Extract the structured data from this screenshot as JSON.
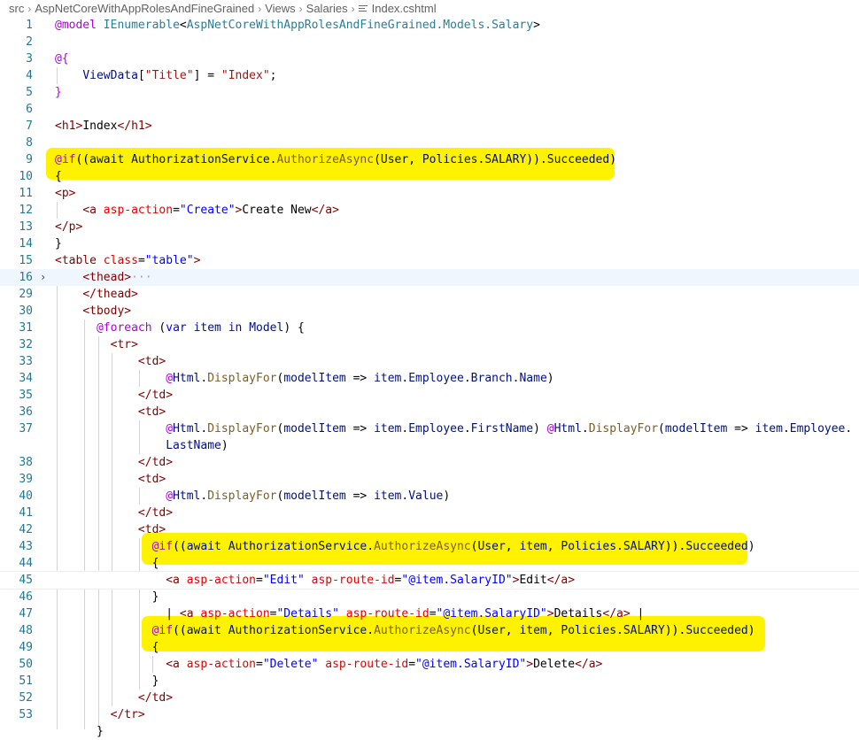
{
  "breadcrumb": {
    "parts": [
      "src",
      "AspNetCoreWithAppRolesAndFineGrained",
      "Views",
      "Salaries",
      "Index.cshtml"
    ]
  },
  "lines": [
    {
      "n": "1",
      "t": [
        [
          "at",
          "@model"
        ],
        [
          "txt",
          " "
        ],
        [
          "type",
          "IEnumerable"
        ],
        [
          "txt",
          "<"
        ],
        [
          "type",
          "AspNetCoreWithAppRolesAndFineGrained.Models.Salary"
        ],
        [
          "txt",
          ">"
        ]
      ]
    },
    {
      "n": "2",
      "t": []
    },
    {
      "n": "3",
      "t": [
        [
          "at",
          "@{"
        ]
      ]
    },
    {
      "n": "4",
      "t": [
        [
          "txt",
          "    "
        ],
        [
          "var",
          "ViewData"
        ],
        [
          "txt",
          "["
        ],
        [
          "str2",
          "\"Title\""
        ],
        [
          "txt",
          "] = "
        ],
        [
          "str2",
          "\"Index\""
        ],
        [
          "txt",
          ";"
        ]
      ]
    },
    {
      "n": "5",
      "t": [
        [
          "at",
          "}"
        ]
      ]
    },
    {
      "n": "6",
      "t": []
    },
    {
      "n": "7",
      "t": [
        [
          "tag",
          "<h1>"
        ],
        [
          "txt",
          "Index"
        ],
        [
          "tag",
          "</h1>"
        ]
      ]
    },
    {
      "n": "8",
      "t": []
    },
    {
      "n": "9",
      "t": [
        [
          "kwc",
          "@if"
        ],
        [
          "txt",
          "(("
        ],
        [
          "var",
          "await"
        ],
        [
          "txt",
          " "
        ],
        [
          "var",
          "AuthorizationService"
        ],
        [
          "txt",
          "."
        ],
        [
          "fn",
          "AuthorizeAsync"
        ],
        [
          "txt",
          "("
        ],
        [
          "var",
          "User"
        ],
        [
          "txt",
          ", "
        ],
        [
          "var",
          "Policies"
        ],
        [
          "txt",
          "."
        ],
        [
          "var",
          "SALARY"
        ],
        [
          "txt",
          "))."
        ],
        [
          "var",
          "Succeeded"
        ],
        [
          "txt",
          ")"
        ]
      ]
    },
    {
      "n": "10",
      "t": [
        [
          "txt",
          "{"
        ]
      ]
    },
    {
      "n": "11",
      "t": [
        [
          "tag",
          "<p>"
        ]
      ]
    },
    {
      "n": "12",
      "t": [
        [
          "txt",
          "    "
        ],
        [
          "tag",
          "<a"
        ],
        [
          "txt",
          " "
        ],
        [
          "attr",
          "asp-action"
        ],
        [
          "txt",
          "="
        ],
        [
          "str",
          "\"Create\""
        ],
        [
          "tag",
          ">"
        ],
        [
          "txt",
          "Create New"
        ],
        [
          "tag",
          "</a>"
        ]
      ]
    },
    {
      "n": "13",
      "t": [
        [
          "tag",
          "</p>"
        ]
      ]
    },
    {
      "n": "14",
      "t": [
        [
          "txt",
          "}"
        ]
      ]
    },
    {
      "n": "15",
      "t": [
        [
          "tag",
          "<table"
        ],
        [
          "txt",
          " "
        ],
        [
          "attr",
          "class"
        ],
        [
          "txt",
          "="
        ],
        [
          "str",
          "\"table\""
        ],
        [
          "tag",
          ">"
        ]
      ]
    },
    {
      "n": "16",
      "t": [
        [
          "txt",
          "    "
        ],
        [
          "tag",
          "<thead>"
        ],
        [
          "ph",
          "···"
        ]
      ]
    },
    {
      "n": "29",
      "t": [
        [
          "txt",
          "    "
        ],
        [
          "tag",
          "</thead>"
        ]
      ]
    },
    {
      "n": "30",
      "t": [
        [
          "txt",
          "    "
        ],
        [
          "tag",
          "<tbody>"
        ]
      ]
    },
    {
      "n": "31",
      "t": [
        [
          "txt",
          "      "
        ],
        [
          "kwc",
          "@foreach"
        ],
        [
          "txt",
          " ("
        ],
        [
          "kw",
          "var"
        ],
        [
          "txt",
          " "
        ],
        [
          "var",
          "item"
        ],
        [
          "txt",
          " "
        ],
        [
          "kw",
          "in"
        ],
        [
          "txt",
          " "
        ],
        [
          "var",
          "Model"
        ],
        [
          "txt",
          ") {"
        ]
      ]
    },
    {
      "n": "32",
      "t": [
        [
          "txt",
          "        "
        ],
        [
          "tag",
          "<tr>"
        ]
      ]
    },
    {
      "n": "33",
      "t": [
        [
          "txt",
          "            "
        ],
        [
          "tag",
          "<td>"
        ]
      ]
    },
    {
      "n": "34",
      "t": [
        [
          "txt",
          "                "
        ],
        [
          "at",
          "@"
        ],
        [
          "var",
          "Html"
        ],
        [
          "txt",
          "."
        ],
        [
          "fn",
          "DisplayFor"
        ],
        [
          "txt",
          "("
        ],
        [
          "var",
          "modelItem"
        ],
        [
          "txt",
          " => "
        ],
        [
          "var",
          "item"
        ],
        [
          "txt",
          "."
        ],
        [
          "var",
          "Employee"
        ],
        [
          "txt",
          "."
        ],
        [
          "var",
          "Branch"
        ],
        [
          "txt",
          "."
        ],
        [
          "var",
          "Name"
        ],
        [
          "txt",
          ")"
        ]
      ]
    },
    {
      "n": "35",
      "t": [
        [
          "txt",
          "            "
        ],
        [
          "tag",
          "</td>"
        ]
      ]
    },
    {
      "n": "36",
      "t": [
        [
          "txt",
          "            "
        ],
        [
          "tag",
          "<td>"
        ]
      ]
    },
    {
      "n": "37",
      "t": [
        [
          "txt",
          "                "
        ],
        [
          "at",
          "@"
        ],
        [
          "var",
          "Html"
        ],
        [
          "txt",
          "."
        ],
        [
          "fn",
          "DisplayFor"
        ],
        [
          "txt",
          "("
        ],
        [
          "var",
          "modelItem"
        ],
        [
          "txt",
          " => "
        ],
        [
          "var",
          "item"
        ],
        [
          "txt",
          "."
        ],
        [
          "var",
          "Employee"
        ],
        [
          "txt",
          "."
        ],
        [
          "var",
          "FirstName"
        ],
        [
          "txt",
          ") "
        ],
        [
          "at",
          "@"
        ],
        [
          "var",
          "Html"
        ],
        [
          "txt",
          "."
        ],
        [
          "fn",
          "DisplayFor"
        ],
        [
          "txt",
          "("
        ],
        [
          "var",
          "modelItem"
        ],
        [
          "txt",
          " => "
        ],
        [
          "var",
          "item"
        ],
        [
          "txt",
          "."
        ],
        [
          "var",
          "Employee"
        ],
        [
          "txt",
          "."
        ]
      ]
    },
    {
      "n": "",
      "t": [
        [
          "txt",
          "                "
        ],
        [
          "var",
          "LastName"
        ],
        [
          "txt",
          ")"
        ]
      ]
    },
    {
      "n": "38",
      "t": [
        [
          "txt",
          "            "
        ],
        [
          "tag",
          "</td>"
        ]
      ]
    },
    {
      "n": "39",
      "t": [
        [
          "txt",
          "            "
        ],
        [
          "tag",
          "<td>"
        ]
      ]
    },
    {
      "n": "40",
      "t": [
        [
          "txt",
          "                "
        ],
        [
          "at",
          "@"
        ],
        [
          "var",
          "Html"
        ],
        [
          "txt",
          "."
        ],
        [
          "fn",
          "DisplayFor"
        ],
        [
          "txt",
          "("
        ],
        [
          "var",
          "modelItem"
        ],
        [
          "txt",
          " => "
        ],
        [
          "var",
          "item"
        ],
        [
          "txt",
          "."
        ],
        [
          "var",
          "Value"
        ],
        [
          "txt",
          ")"
        ]
      ]
    },
    {
      "n": "41",
      "t": [
        [
          "txt",
          "            "
        ],
        [
          "tag",
          "</td>"
        ]
      ]
    },
    {
      "n": "42",
      "t": [
        [
          "txt",
          "            "
        ],
        [
          "tag",
          "<td>"
        ]
      ]
    },
    {
      "n": "43",
      "t": [
        [
          "txt",
          "              "
        ],
        [
          "kwc",
          "@if"
        ],
        [
          "txt",
          "(("
        ],
        [
          "var",
          "await"
        ],
        [
          "txt",
          " "
        ],
        [
          "var",
          "AuthorizationService"
        ],
        [
          "txt",
          "."
        ],
        [
          "fn",
          "AuthorizeAsync"
        ],
        [
          "txt",
          "("
        ],
        [
          "var",
          "User"
        ],
        [
          "txt",
          ", "
        ],
        [
          "var",
          "item"
        ],
        [
          "txt",
          ", "
        ],
        [
          "var",
          "Policies"
        ],
        [
          "txt",
          "."
        ],
        [
          "var",
          "SALARY"
        ],
        [
          "txt",
          "))."
        ],
        [
          "var",
          "Succeeded"
        ],
        [
          "txt",
          ")"
        ]
      ]
    },
    {
      "n": "44",
      "t": [
        [
          "txt",
          "              {"
        ]
      ]
    },
    {
      "n": "45",
      "t": [
        [
          "txt",
          "                "
        ],
        [
          "tag",
          "<a"
        ],
        [
          "txt",
          " "
        ],
        [
          "attr",
          "asp-action"
        ],
        [
          "txt",
          "="
        ],
        [
          "str",
          "\"Edit\""
        ],
        [
          "txt",
          " "
        ],
        [
          "attr",
          "asp-route-id"
        ],
        [
          "txt",
          "="
        ],
        [
          "str",
          "\"@item.SalaryID\""
        ],
        [
          "tag",
          ">"
        ],
        [
          "txt",
          "Edit"
        ],
        [
          "tag",
          "</a>"
        ]
      ]
    },
    {
      "n": "46",
      "t": [
        [
          "txt",
          "              }"
        ]
      ]
    },
    {
      "n": "47",
      "t": [
        [
          "txt",
          "                | "
        ],
        [
          "tag",
          "<a"
        ],
        [
          "txt",
          " "
        ],
        [
          "attr",
          "asp-action"
        ],
        [
          "txt",
          "="
        ],
        [
          "str",
          "\"Details\""
        ],
        [
          "txt",
          " "
        ],
        [
          "attr",
          "asp-route-id"
        ],
        [
          "txt",
          "="
        ],
        [
          "str",
          "\"@item.SalaryID\""
        ],
        [
          "tag",
          ">"
        ],
        [
          "txt",
          "Details"
        ],
        [
          "tag",
          "</a>"
        ],
        [
          "txt",
          " |"
        ]
      ]
    },
    {
      "n": "48",
      "t": [
        [
          "txt",
          "              "
        ],
        [
          "kwc",
          "@if"
        ],
        [
          "txt",
          "(("
        ],
        [
          "var",
          "await"
        ],
        [
          "txt",
          " "
        ],
        [
          "var",
          "AuthorizationService"
        ],
        [
          "txt",
          "."
        ],
        [
          "fn",
          "AuthorizeAsync"
        ],
        [
          "txt",
          "("
        ],
        [
          "var",
          "User"
        ],
        [
          "txt",
          ", "
        ],
        [
          "var",
          "item"
        ],
        [
          "txt",
          ", "
        ],
        [
          "var",
          "Policies"
        ],
        [
          "txt",
          "."
        ],
        [
          "var",
          "SALARY"
        ],
        [
          "txt",
          "))."
        ],
        [
          "var",
          "Succeeded"
        ],
        [
          "txt",
          ")"
        ]
      ]
    },
    {
      "n": "49",
      "t": [
        [
          "txt",
          "              {"
        ]
      ]
    },
    {
      "n": "50",
      "t": [
        [
          "txt",
          "                "
        ],
        [
          "tag",
          "<a"
        ],
        [
          "txt",
          " "
        ],
        [
          "attr",
          "asp-action"
        ],
        [
          "txt",
          "="
        ],
        [
          "str",
          "\"Delete\""
        ],
        [
          "txt",
          " "
        ],
        [
          "attr",
          "asp-route-id"
        ],
        [
          "txt",
          "="
        ],
        [
          "str",
          "\"@item.SalaryID\""
        ],
        [
          "tag",
          ">"
        ],
        [
          "txt",
          "Delete"
        ],
        [
          "tag",
          "</a>"
        ]
      ]
    },
    {
      "n": "51",
      "t": [
        [
          "txt",
          "              }"
        ]
      ]
    },
    {
      "n": "52",
      "t": [
        [
          "txt",
          "            "
        ],
        [
          "tag",
          "</td>"
        ]
      ]
    },
    {
      "n": "53",
      "t": [
        [
          "txt",
          "        "
        ],
        [
          "tag",
          "</tr>"
        ]
      ]
    },
    {
      "n": "",
      "t": [
        [
          "txt",
          "      }"
        ]
      ]
    }
  ],
  "colors": {
    "highlight": "#fff200",
    "line_number": "#237893",
    "tag": "#800000",
    "attribute": "#e50000",
    "string": "#0000ff",
    "razor": "#af00db",
    "variable": "#001080",
    "type": "#267f99",
    "function": "#795e26"
  },
  "icons": {
    "fold": "chevron-right-icon",
    "file": "file-lines-icon"
  }
}
